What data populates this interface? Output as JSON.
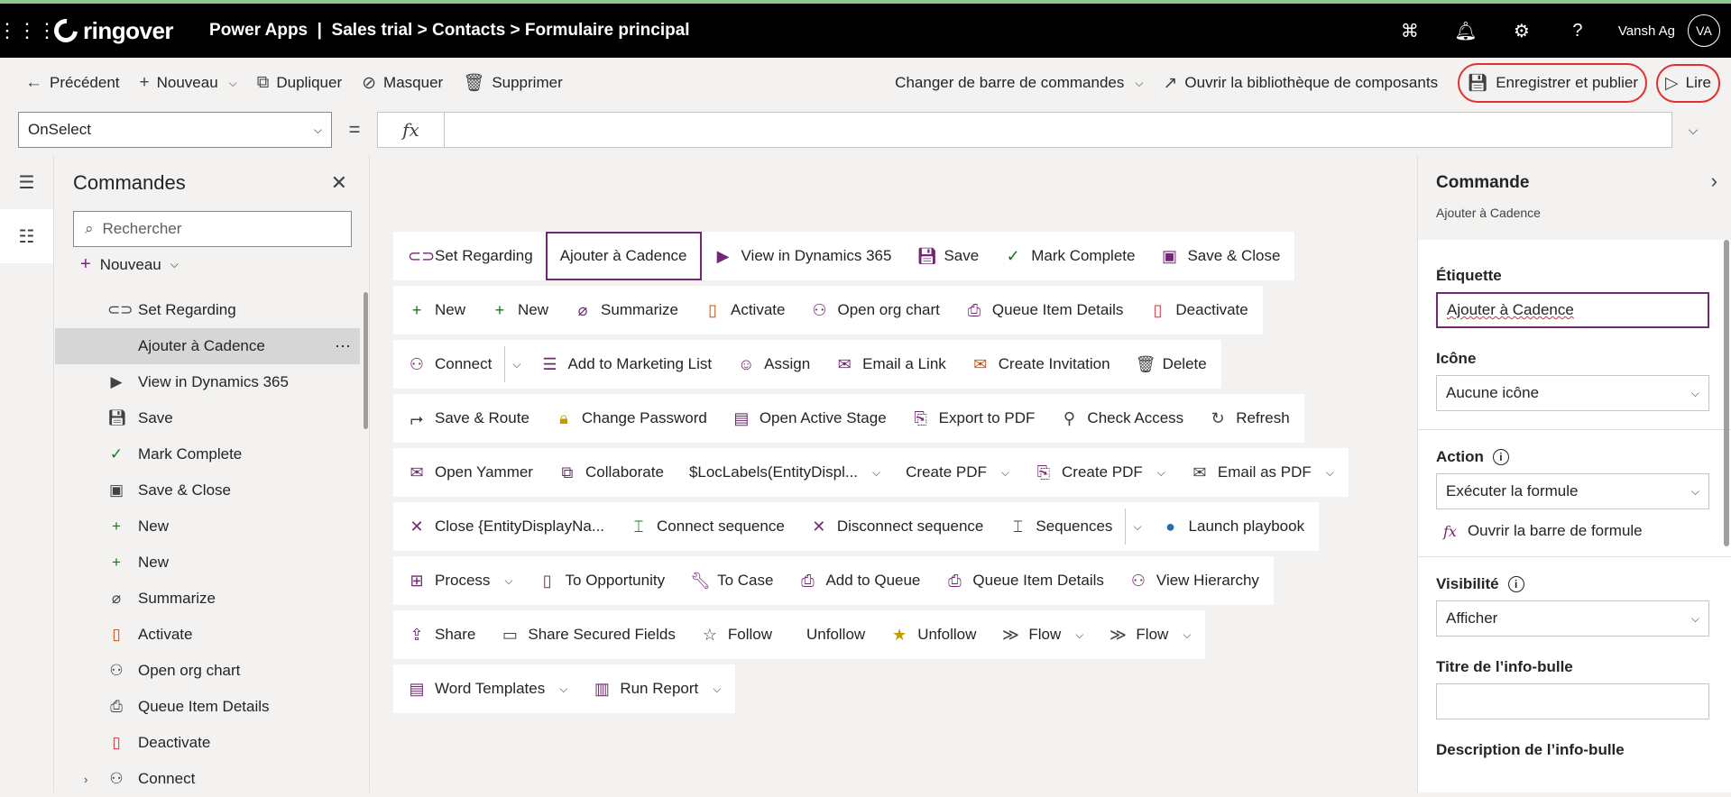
{
  "topbar": {
    "logo": "ringover",
    "breadcrumb": "Power Apps  |  Sales trial > Contacts > Formulaire principal",
    "user_name": "Vansh Ag",
    "avatar_initials": "VA"
  },
  "commandbar": {
    "back": "Précédent",
    "new": "Nouveau",
    "duplicate": "Dupliquer",
    "hide": "Masquer",
    "delete": "Supprimer",
    "change_bar": "Changer de barre de commandes",
    "open_library": "Ouvrir la bibliothèque de composants",
    "save_publish": "Enregistrer et publier",
    "play": "Lire"
  },
  "formula": {
    "property": "OnSelect",
    "fx": "fx",
    "value": ""
  },
  "left_panel": {
    "title": "Commandes",
    "search_placeholder": "Rechercher",
    "new_label": "Nouveau",
    "items": [
      {
        "label": "Set Regarding",
        "icon": "link-icon"
      },
      {
        "label": "Ajouter à Cadence",
        "icon": "",
        "selected": true
      },
      {
        "label": "View in Dynamics 365",
        "icon": "dynamics-icon"
      },
      {
        "label": "Save",
        "icon": "save-icon"
      },
      {
        "label": "Mark Complete",
        "icon": "check-icon"
      },
      {
        "label": "Save & Close",
        "icon": "save-close-icon"
      },
      {
        "label": "New",
        "icon": "plus-icon"
      },
      {
        "label": "New",
        "icon": "plus-icon"
      },
      {
        "label": "Summarize",
        "icon": "summarize-icon"
      },
      {
        "label": "Activate",
        "icon": "document-icon"
      },
      {
        "label": "Open org chart",
        "icon": "org-chart-icon"
      },
      {
        "label": "Queue Item Details",
        "icon": "queue-icon"
      },
      {
        "label": "Deactivate",
        "icon": "deactivate-icon"
      },
      {
        "label": "Connect",
        "icon": "connect-icon"
      }
    ]
  },
  "canvas": {
    "rows": [
      [
        {
          "label": "Set Regarding",
          "icon": "link-icon"
        },
        {
          "label": "Ajouter à Cadence",
          "selected": true
        },
        {
          "label": "View in Dynamics 365",
          "icon": "dynamics-icon"
        },
        {
          "label": "Save",
          "icon": "save-icon"
        },
        {
          "label": "Mark Complete",
          "icon": "check-icon"
        },
        {
          "label": "Save & Close",
          "icon": "save-close-icon"
        }
      ],
      [
        {
          "label": "New",
          "icon": "plus-icon"
        },
        {
          "label": "New",
          "icon": "plus-icon"
        },
        {
          "label": "Summarize",
          "icon": "summarize-icon"
        },
        {
          "label": "Activate",
          "icon": "document-icon"
        },
        {
          "label": "Open org chart",
          "icon": "org-chart-icon"
        },
        {
          "label": "Queue Item Details",
          "icon": "queue-icon"
        },
        {
          "label": "Deactivate",
          "icon": "deactivate-icon"
        }
      ],
      [
        {
          "label": "Connect",
          "icon": "connect-icon",
          "split": true
        },
        {
          "label": "Add to Marketing List",
          "icon": "list-add-icon"
        },
        {
          "label": "Assign",
          "icon": "assign-icon"
        },
        {
          "label": "Email a Link",
          "icon": "email-link-icon"
        },
        {
          "label": "Create Invitation",
          "icon": "invitation-icon"
        },
        {
          "label": "Delete",
          "icon": "trash-icon"
        }
      ],
      [
        {
          "label": "Save & Route",
          "icon": "route-icon"
        },
        {
          "label": "Change Password",
          "icon": "lock-icon"
        },
        {
          "label": "Open Active Stage",
          "icon": "stage-icon"
        },
        {
          "label": "Export to PDF",
          "icon": "pdf-icon"
        },
        {
          "label": "Check Access",
          "icon": "check-access-icon"
        },
        {
          "label": "Refresh",
          "icon": "refresh-icon"
        }
      ],
      [
        {
          "label": "Open Yammer",
          "icon": "yammer-icon"
        },
        {
          "label": "Collaborate",
          "icon": "teams-icon"
        },
        {
          "label": "$LocLabels(EntityDispl...",
          "icon": "",
          "chevron": true
        },
        {
          "label": "Create PDF",
          "icon": "",
          "chevron": true
        },
        {
          "label": "Create PDF",
          "icon": "pdf-icon",
          "chevron": true
        },
        {
          "label": "Email as PDF",
          "icon": "email-icon",
          "chevron": true
        }
      ],
      [
        {
          "label": "Close {EntityDisplayNa...",
          "icon": "close-icon"
        },
        {
          "label": "Connect sequence",
          "icon": "sequence-icon"
        },
        {
          "label": "Disconnect sequence",
          "icon": "close-icon"
        },
        {
          "label": "Sequences",
          "icon": "sequences-icon",
          "split": true
        },
        {
          "label": "Launch playbook",
          "icon": "playbook-icon"
        }
      ],
      [
        {
          "label": "Process",
          "icon": "process-icon",
          "chevron": true
        },
        {
          "label": "To Opportunity",
          "icon": "document-icon"
        },
        {
          "label": "To Case",
          "icon": "wrench-icon"
        },
        {
          "label": "Add to Queue",
          "icon": "queue-add-icon"
        },
        {
          "label": "Queue Item Details",
          "icon": "queue-icon"
        },
        {
          "label": "View Hierarchy",
          "icon": "hierarchy-icon"
        }
      ],
      [
        {
          "label": "Share",
          "icon": "share-icon"
        },
        {
          "label": "Share Secured Fields",
          "icon": "secured-fields-icon"
        },
        {
          "label": "Follow",
          "icon": "star-outline-icon"
        },
        {
          "label": "Unfollow",
          "icon": ""
        },
        {
          "label": "Unfollow",
          "icon": "star-icon"
        },
        {
          "label": "Flow",
          "icon": "flow-icon",
          "chevron": true
        },
        {
          "label": "Flow",
          "icon": "flow-icon",
          "chevron": true
        }
      ],
      [
        {
          "label": "Word Templates",
          "icon": "word-icon",
          "chevron": true
        },
        {
          "label": "Run Report",
          "icon": "report-icon",
          "chevron": true
        }
      ]
    ]
  },
  "right_panel": {
    "title": "Commande",
    "subtitle": "Ajouter à Cadence",
    "label_heading": "Étiquette",
    "label_value": "Ajouter à Cadence",
    "icon_heading": "Icône",
    "icon_value": "Aucune icône",
    "action_heading": "Action",
    "action_value": "Exécuter la formule",
    "open_formula": "Ouvrir la barre de formule",
    "visibility_heading": "Visibilité",
    "visibility_value": "Afficher",
    "tooltip_title_heading": "Titre de l’info-bulle",
    "tooltip_title_value": "",
    "tooltip_desc_heading": "Description de l’info-bulle"
  },
  "colors": {
    "accent": "#742774",
    "highlight": "#e03131",
    "topbar": "#000000"
  }
}
